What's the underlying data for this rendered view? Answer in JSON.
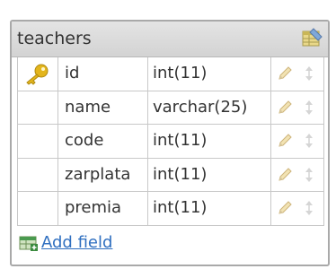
{
  "table": {
    "title": "teachers",
    "fields": [
      {
        "name": "id",
        "type": "int(11)",
        "primary_key": true
      },
      {
        "name": "name",
        "type": "varchar(25)",
        "primary_key": false
      },
      {
        "name": "code",
        "type": "int(11)",
        "primary_key": false
      },
      {
        "name": "zarplata",
        "type": "int(11)",
        "primary_key": false
      },
      {
        "name": "premia",
        "type": "int(11)",
        "primary_key": false
      }
    ],
    "add_field_label": "Add field"
  },
  "icons": {
    "header": "table-icon",
    "key": "key-icon",
    "edit": "pencil-icon",
    "move": "up-down-arrows-icon",
    "add": "add-field-icon"
  },
  "colors": {
    "link": "#2f6fc0",
    "key": "#e3b51c",
    "header_bg": "#dcdcdc",
    "border": "#a9a9a9"
  }
}
